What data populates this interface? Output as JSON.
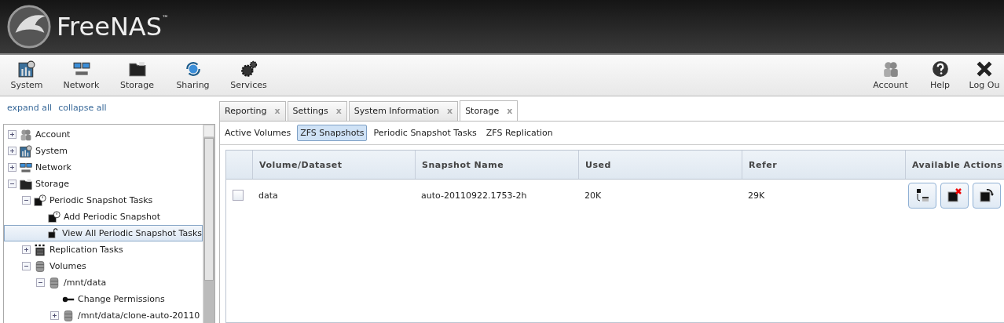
{
  "header": {
    "logo_text": "FreeNAS",
    "trademark": "™"
  },
  "toolbar": {
    "left": [
      {
        "label": "System",
        "kind": "system"
      },
      {
        "label": "Network",
        "kind": "network"
      },
      {
        "label": "Storage",
        "kind": "storage"
      },
      {
        "label": "Sharing",
        "kind": "sharing"
      },
      {
        "label": "Services",
        "kind": "services"
      }
    ],
    "right": [
      {
        "label": "Account",
        "kind": "account"
      },
      {
        "label": "Help",
        "kind": "help"
      },
      {
        "label": "Log Ou",
        "kind": "logout"
      }
    ]
  },
  "sidebar": {
    "links": [
      "expand all",
      "collapse all"
    ],
    "tree": [
      {
        "label": "Account",
        "kind": "account",
        "expanded": false,
        "selected": false
      },
      {
        "label": "System",
        "kind": "system",
        "expanded": false,
        "selected": false
      },
      {
        "label": "Network",
        "kind": "network",
        "expanded": false,
        "selected": false
      },
      {
        "label": "Storage",
        "kind": "storage",
        "expanded": true,
        "selected": false,
        "children": [
          {
            "label": "Periodic Snapshot Tasks",
            "kind": "clock",
            "expanded": true,
            "selected": false,
            "children": [
              {
                "label": "Add Periodic Snapshot",
                "kind": "clock",
                "selected": false
              },
              {
                "label": "View All Periodic Snapshot Tasks",
                "kind": "lock",
                "selected": true
              }
            ]
          },
          {
            "label": "Replication Tasks",
            "kind": "replication",
            "expanded": false,
            "selected": false
          },
          {
            "label": "Volumes",
            "kind": "disk",
            "expanded": true,
            "selected": false,
            "children": [
              {
                "label": "/mnt/data",
                "kind": "disk",
                "expanded": true,
                "selected": false,
                "children": [
                  {
                    "label": "Change Permissions",
                    "kind": "key",
                    "selected": false
                  },
                  {
                    "label": "/mnt/data/clone-auto-20110",
                    "kind": "disk",
                    "expanded": false,
                    "selected": false
                  }
                ]
              }
            ]
          }
        ]
      }
    ]
  },
  "tabs": [
    {
      "label": "Reporting",
      "close": "x",
      "selected": false
    },
    {
      "label": "Settings",
      "close": "x",
      "selected": false
    },
    {
      "label": "System Information",
      "close": "x",
      "selected": false
    },
    {
      "label": "Storage",
      "close": "x",
      "selected": true
    }
  ],
  "subtabs": [
    {
      "label": "Active Volumes",
      "selected": false
    },
    {
      "label": "ZFS Snapshots",
      "selected": true
    },
    {
      "label": "Periodic Snapshot Tasks",
      "selected": false
    },
    {
      "label": "ZFS Replication",
      "selected": false
    }
  ],
  "table": {
    "columns": [
      "Volume/Dataset",
      "Snapshot Name",
      "Used",
      "Refer",
      "Available Actions"
    ],
    "rows": [
      {
        "checked": false,
        "cells": [
          "data",
          "auto-20110922.1753-2h",
          "20K",
          "29K"
        ],
        "actions": [
          {
            "kind": "clone"
          },
          {
            "kind": "destroy"
          },
          {
            "kind": "rollback"
          }
        ]
      }
    ]
  }
}
